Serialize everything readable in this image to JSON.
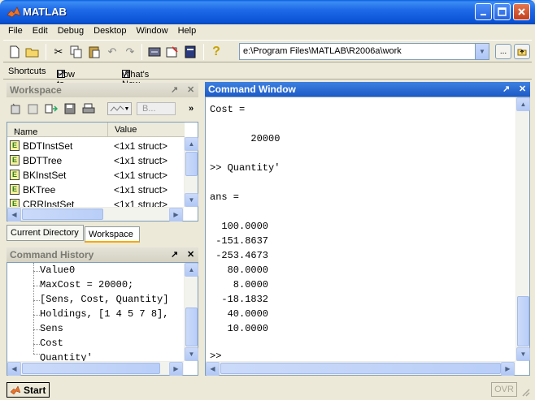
{
  "window": {
    "title": "MATLAB"
  },
  "menu": [
    "File",
    "Edit",
    "Debug",
    "Desktop",
    "Window",
    "Help"
  ],
  "toolbar": {
    "current_directory": "e:\\Program Files\\MATLAB\\R2006a\\work",
    "browse_label": "..."
  },
  "shortcuts": {
    "label": "Shortcuts",
    "items": [
      "How to Add",
      "What's New"
    ]
  },
  "workspace": {
    "title": "Workspace",
    "filter_label": "B...",
    "columns": [
      "Name",
      "Value"
    ],
    "rows": [
      {
        "name": "BDTInstSet",
        "value": "<1x1 struct>"
      },
      {
        "name": "BDTTree",
        "value": "<1x1 struct>"
      },
      {
        "name": "BKInstSet",
        "value": "<1x1 struct>"
      },
      {
        "name": "BKTree",
        "value": "<1x1 struct>"
      },
      {
        "name": "CRRInstSet",
        "value": "<1x1 struct>"
      }
    ],
    "tabs": [
      "Current Directory",
      "Workspace"
    ]
  },
  "history": {
    "title": "Command History",
    "lines": [
      "Value0",
      "MaxCost = 20000;",
      "[Sens, Cost, Quantity]",
      "Holdings, [1 4 5 7 8],",
      "Sens",
      "Cost",
      "Quantity'"
    ]
  },
  "command_window": {
    "title": "Command Window",
    "lines": [
      "Cost =",
      "",
      "       20000",
      "",
      ">> Quantity'",
      "",
      "ans =",
      "",
      "  100.0000",
      " -151.8637",
      " -253.4673",
      "   80.0000",
      "    8.0000",
      "  -18.1832",
      "   40.0000",
      "   10.0000",
      "",
      ">>"
    ]
  },
  "statusbar": {
    "start_label": "Start",
    "ovr_label": "OVR"
  }
}
